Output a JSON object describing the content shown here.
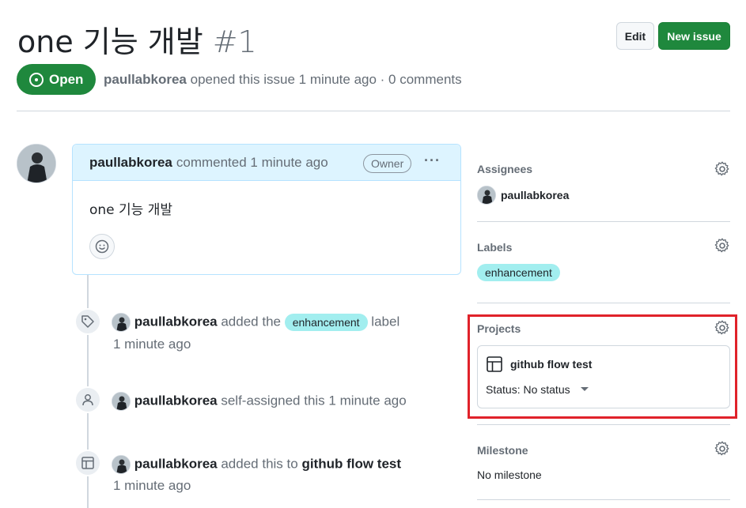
{
  "issue": {
    "title": "one 기능 개발",
    "number": "#1",
    "state": "Open",
    "author": "paullabkorea",
    "meta_text": "opened this issue 1 minute ago · 0 comments"
  },
  "header_buttons": {
    "edit": "Edit",
    "new_issue": "New issue"
  },
  "comment": {
    "author": "paullabkorea",
    "action": "commented 1 minute ago",
    "badge": "Owner",
    "menu": "···",
    "body": "one 기능 개발"
  },
  "timeline": [
    {
      "actor": "paullabkorea",
      "text_before": "added the",
      "label": "enhancement",
      "text_after": "label",
      "time": "1 minute ago",
      "icon": "tag-icon"
    },
    {
      "actor": "paullabkorea",
      "text": "self-assigned this 1 minute ago",
      "icon": "person-icon"
    },
    {
      "actor": "paullabkorea",
      "text_before": "added this to",
      "project": "github flow test",
      "time": "1 minute ago",
      "icon": "table-icon"
    }
  ],
  "sidebar": {
    "assignees": {
      "heading": "Assignees",
      "user": "paullabkorea"
    },
    "labels": {
      "heading": "Labels",
      "label": "enhancement",
      "label_color": "#a2eeef"
    },
    "projects": {
      "heading": "Projects",
      "name": "github flow test",
      "status_text": "Status: No status"
    },
    "milestone": {
      "heading": "Milestone",
      "value": "No milestone"
    }
  },
  "colors": {
    "open_green": "#1f883d",
    "highlight_red": "#e0222a",
    "comment_header_bg": "#ddf4ff"
  }
}
